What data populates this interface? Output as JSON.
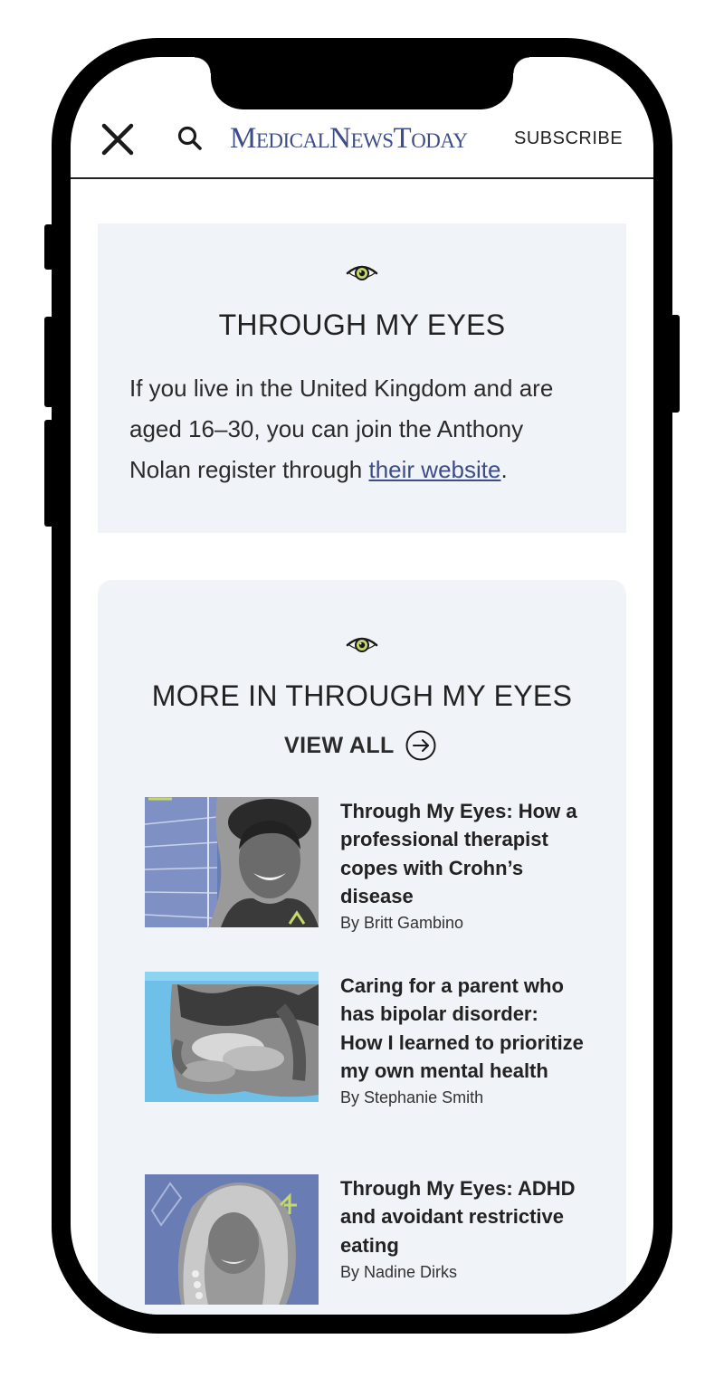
{
  "header": {
    "logo_text": "MedicalNewsToday",
    "subscribe_label": "SUBSCRIBE"
  },
  "callout": {
    "title": "THROUGH MY EYES",
    "body_prefix": "If you live in the United Kingdom and are aged 16–30, you can join the Anthony Nolan register through ",
    "link_text": "their website",
    "body_suffix": "."
  },
  "more": {
    "title": "MORE IN THROUGH MY EYES",
    "view_all_label": "VIEW ALL",
    "articles": [
      {
        "title": "Through My Eyes: How a professional therapist copes with Crohn’s disease",
        "author": "By Britt Gambino"
      },
      {
        "title": "Caring for a parent who has bipolar disorder: How I learned to prioritize my own mental health",
        "author": "By Stephanie Smith"
      },
      {
        "title": "Through My Eyes: ADHD and avoidant restrictive eating",
        "author": "By Nadine Dirks"
      }
    ]
  },
  "colors": {
    "brand": "#3d4d8a",
    "card_bg": "#f0f3f8",
    "eye_iris": "#c7d86a"
  },
  "icons": [
    "close-icon",
    "search-icon",
    "eye-icon",
    "arrow-right-circle-icon"
  ]
}
